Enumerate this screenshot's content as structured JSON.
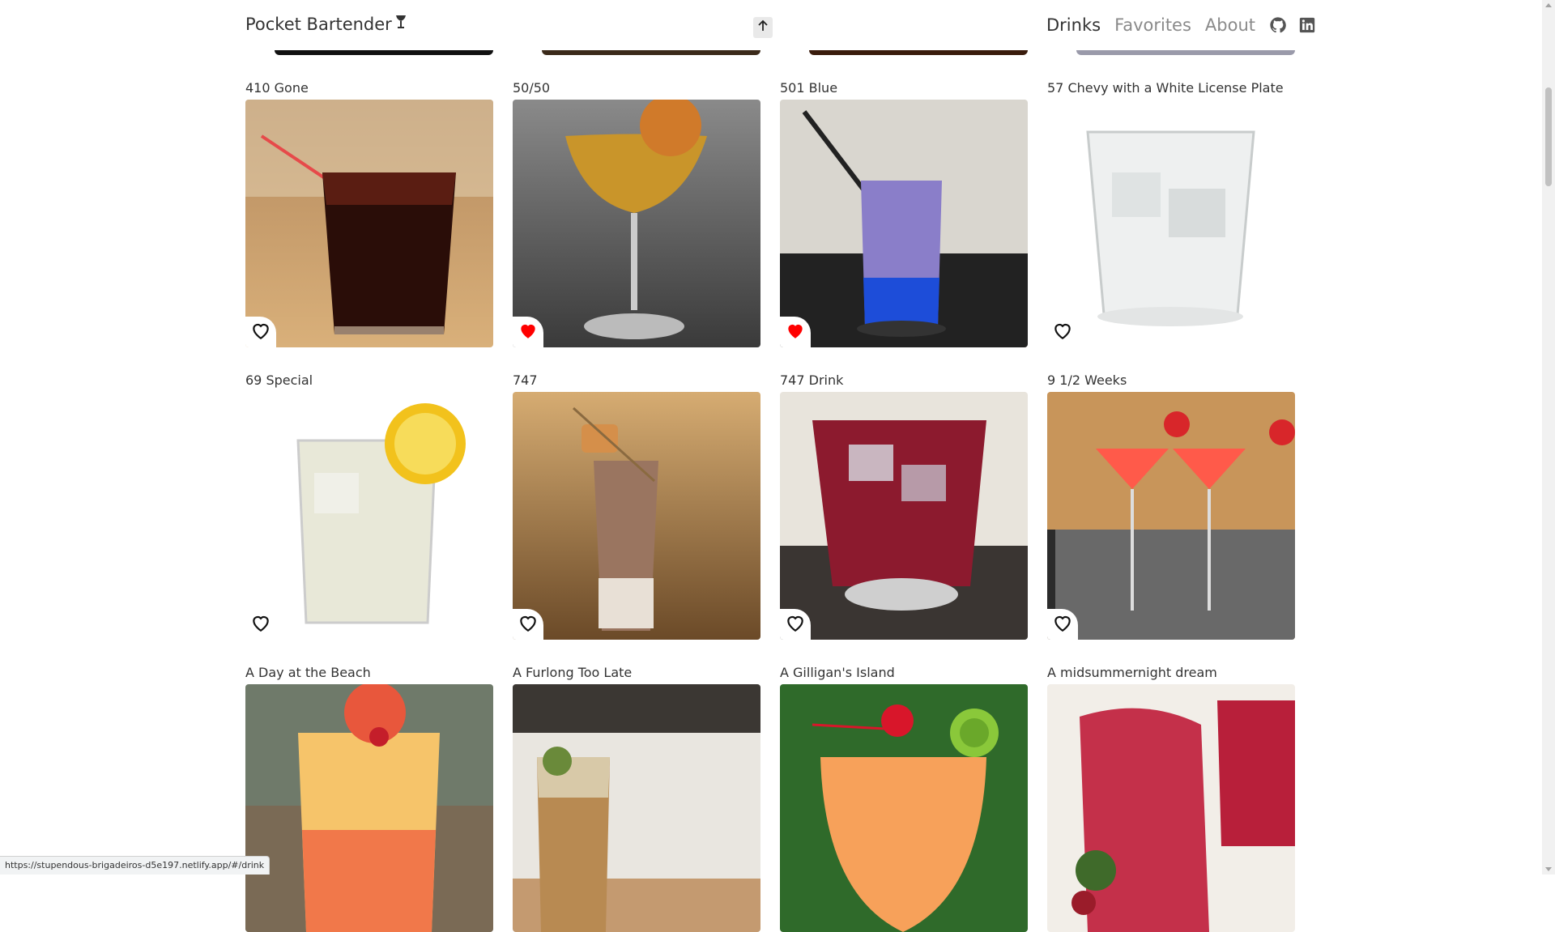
{
  "brand": {
    "name": "Pocket Bartender",
    "icon": "cocktail-glass-icon"
  },
  "nav": {
    "links": [
      {
        "label": "Drinks",
        "active": true
      },
      {
        "label": "Favorites",
        "active": false
      },
      {
        "label": "About",
        "active": false
      }
    ],
    "icons": [
      "github-icon",
      "linkedin-icon"
    ]
  },
  "scroll_to_top": {
    "icon": "arrow-up-icon"
  },
  "drinks": [
    {
      "name": "410 Gone",
      "favorite": false
    },
    {
      "name": "50/50",
      "favorite": true
    },
    {
      "name": "501 Blue",
      "favorite": true
    },
    {
      "name": "57 Chevy with a White License Plate",
      "favorite": false
    },
    {
      "name": "69 Special",
      "favorite": false
    },
    {
      "name": "747",
      "favorite": false
    },
    {
      "name": "747 Drink",
      "favorite": false
    },
    {
      "name": "9 1/2 Weeks",
      "favorite": false
    },
    {
      "name": "A Day at the Beach",
      "favorite": false
    },
    {
      "name": "A Furlong Too Late",
      "favorite": false
    },
    {
      "name": "A Gilligan's Island",
      "favorite": false
    },
    {
      "name": "A midsummernight dream",
      "favorite": false
    }
  ],
  "colors": {
    "favorite_active": "#ff0000",
    "nav_active": "#333333",
    "nav_inactive": "#8a8a8a"
  },
  "status_bar": {
    "url": "https://stupendous-brigadeiros-d5e197.netlify.app/#/drink"
  }
}
